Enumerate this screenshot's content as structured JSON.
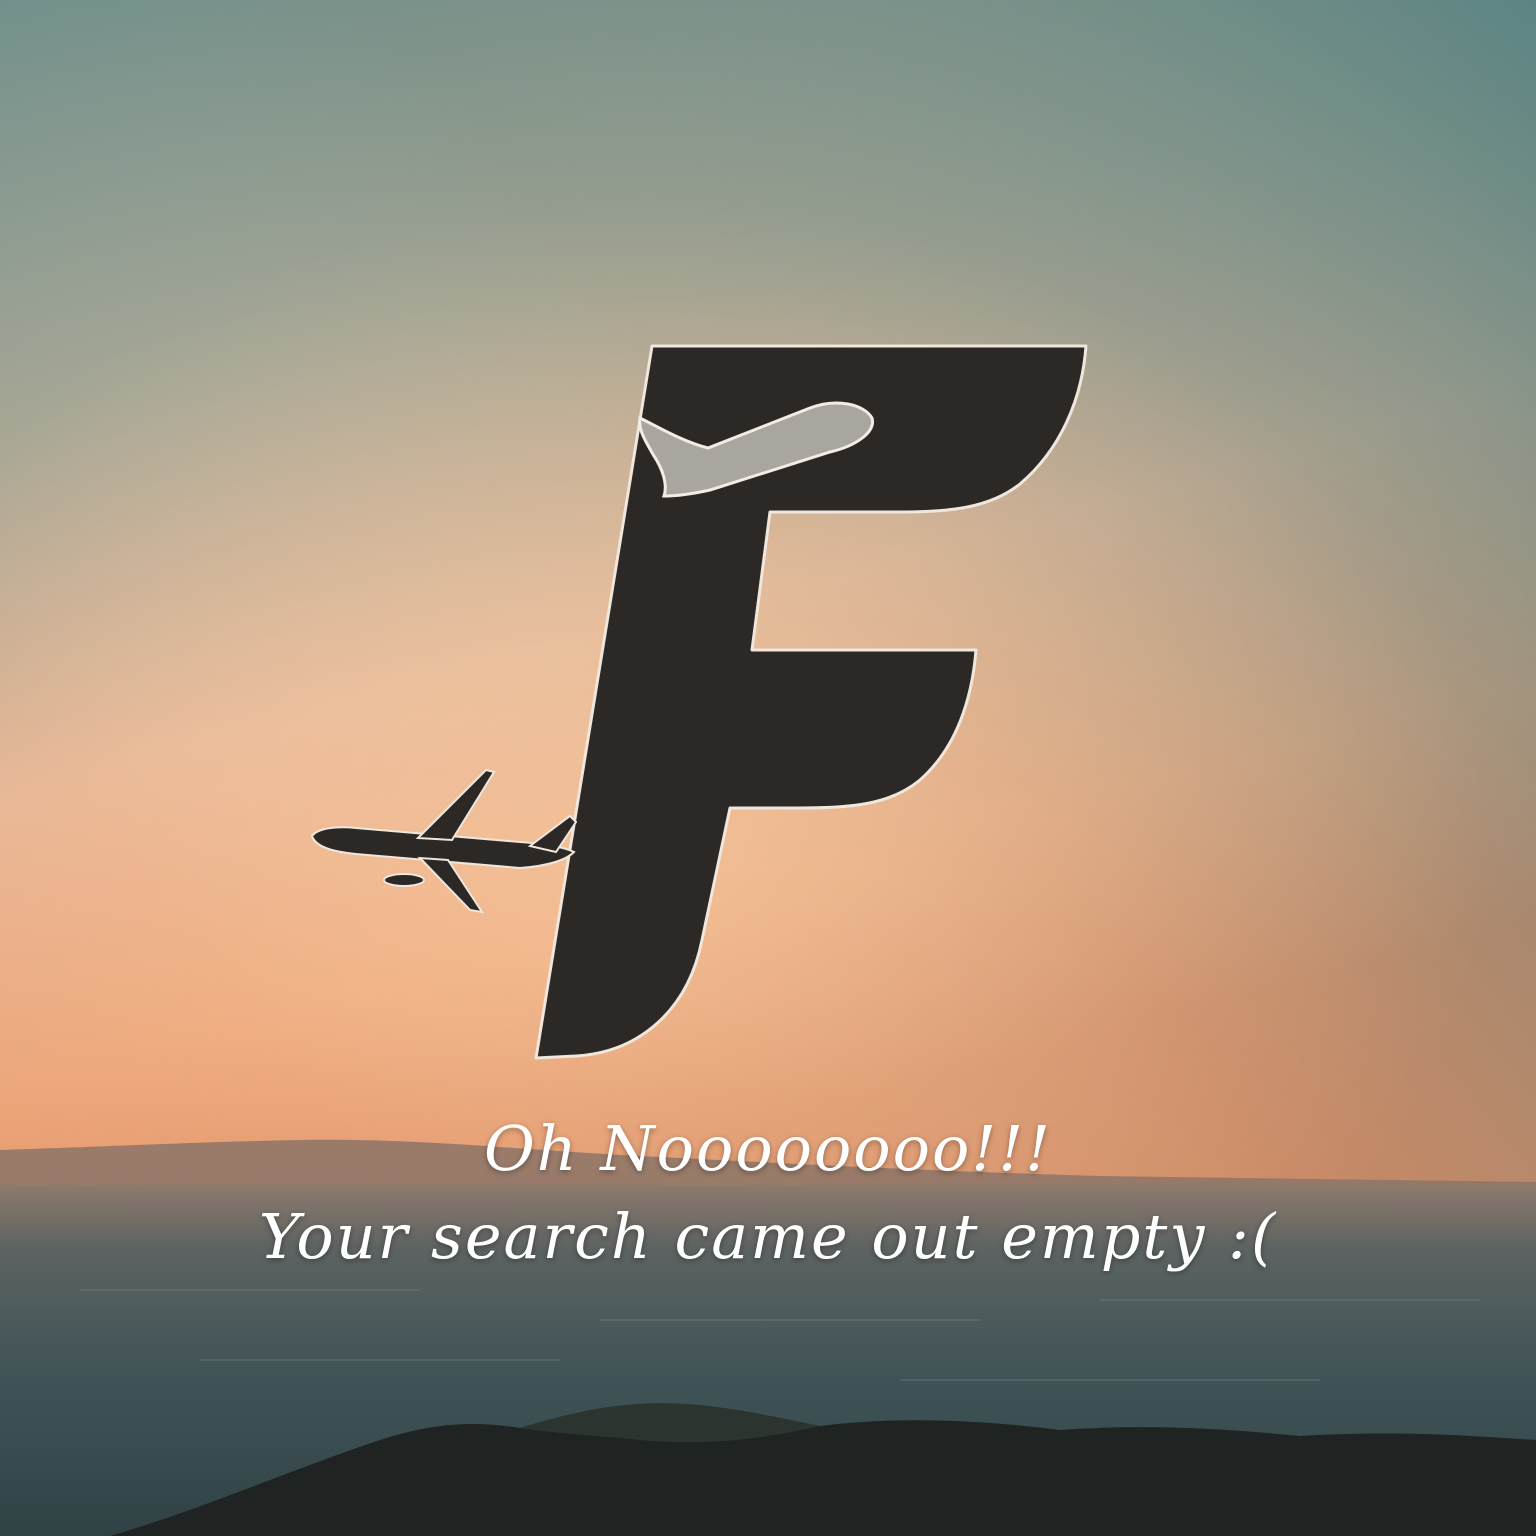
{
  "empty_state": {
    "headline": "Oh Noooooooo!!!",
    "message": "Your search came out empty :("
  },
  "illustration": {
    "logo_icon": "letter-f-airplane-logo",
    "airplane_icon": "airplane-icon",
    "background": "sunset-sea-coastline"
  },
  "colors": {
    "sky_top": "#5f8784",
    "sky_mid": "#b9a591",
    "sky_glow": "#f0a877",
    "horizon": "#d9855a",
    "sea": "#3f5356",
    "land": "#1f2321",
    "logo_fill": "#2a2825",
    "text": "#ffffff"
  }
}
